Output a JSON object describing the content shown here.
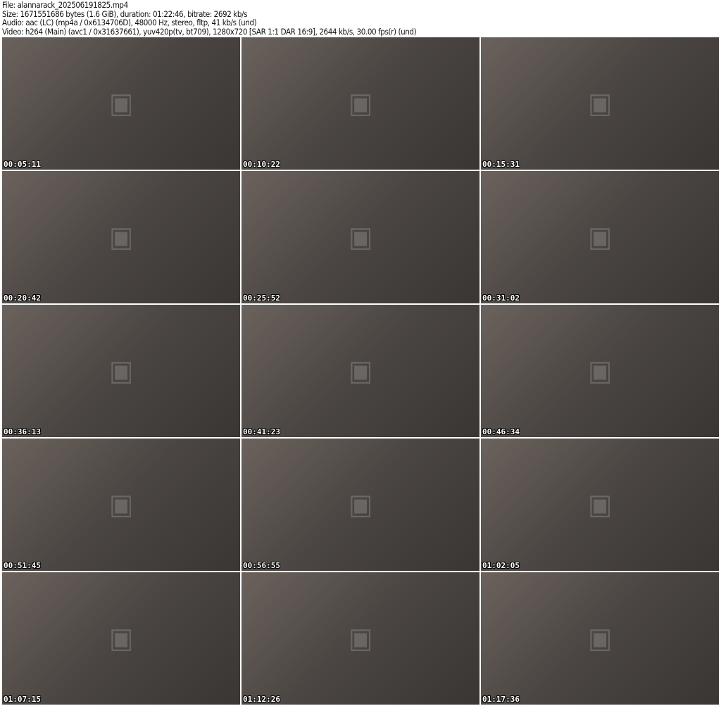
{
  "header": {
    "file": "File: alannarack_202506191825.mp4",
    "size": "Size: 1671551686 bytes (1.6 GiB), duration: 01:22:46, bitrate: 2692 kb/s",
    "audio": "Audio: aac (LC) (mp4a / 0x6134706D), 48000 Hz, stereo, fltp, 41 kb/s (und)",
    "video": "Video: h264 (Main) (avc1 / 0x31637661), yuv420p(tv, bt709), 1280x720 [SAR 1:1 DAR 16:9], 2644 kb/s, 30.00 fps(r) (und)"
  },
  "thumbnails": [
    {
      "timestamp": "00:05:11"
    },
    {
      "timestamp": "00:10:22"
    },
    {
      "timestamp": "00:15:31"
    },
    {
      "timestamp": "00:20:42"
    },
    {
      "timestamp": "00:25:52"
    },
    {
      "timestamp": "00:31:02"
    },
    {
      "timestamp": "00:36:13"
    },
    {
      "timestamp": "00:41:23"
    },
    {
      "timestamp": "00:46:34"
    },
    {
      "timestamp": "00:51:45"
    },
    {
      "timestamp": "00:56:55"
    },
    {
      "timestamp": "01:02:05"
    },
    {
      "timestamp": "01:07:15"
    },
    {
      "timestamp": "01:12:26"
    },
    {
      "timestamp": "01:17:36"
    }
  ]
}
